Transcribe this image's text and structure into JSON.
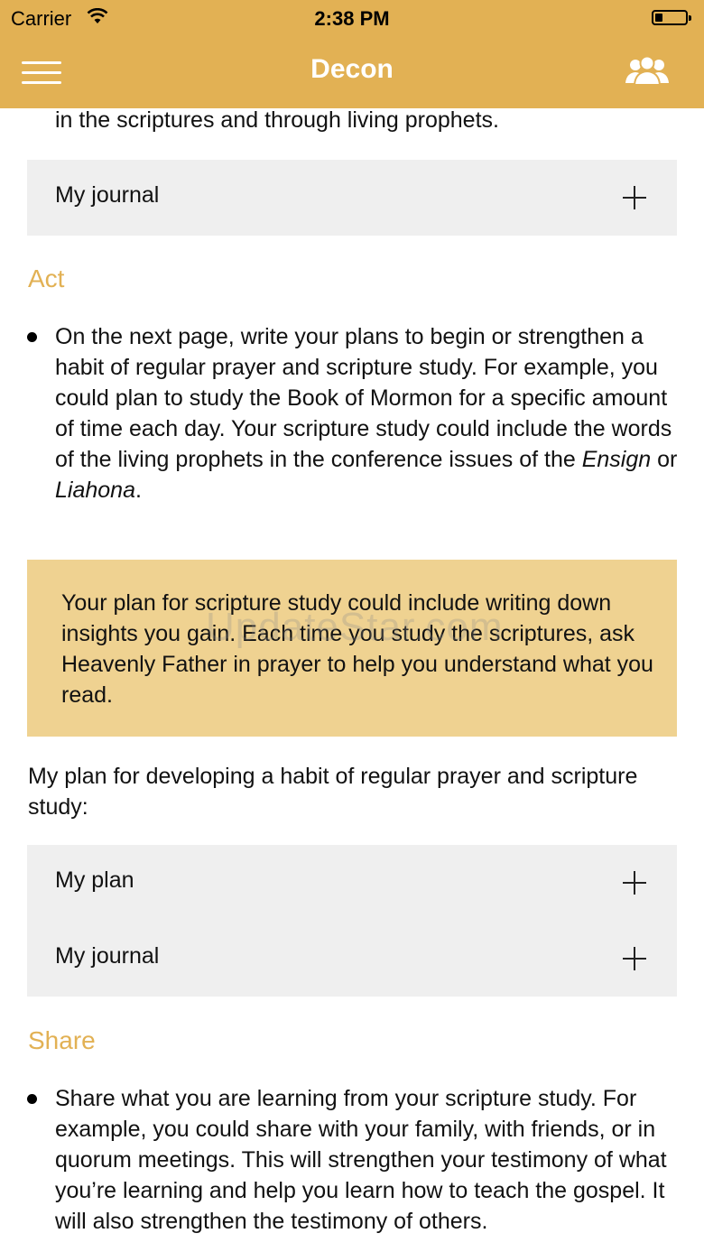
{
  "status_bar": {
    "carrier": "Carrier",
    "time": "2:38 PM"
  },
  "nav": {
    "title": "Decon",
    "menu_icon": "hamburger-menu-icon",
    "people_icon": "people-icon"
  },
  "intro_tail": "in the scriptures and through living prophets.",
  "journal_top": {
    "label": "My journal"
  },
  "act": {
    "heading": "Act",
    "bullet_pre": "On the next page, write your plans to begin or strengthen a habit of regular prayer and scripture study. For example, you could plan to study the Book of Mormon for a specific amount of time each day. Your scripture study could include the words of the living prophets in the conference issues of the ",
    "bullet_em1": "Ensign",
    "bullet_mid": " or ",
    "bullet_em2": "Liahona",
    "bullet_end": "."
  },
  "note": {
    "text": "Your plan for scripture study could include writing down insights you gain. Each time you study the scriptures, ask Heavenly Father in prayer to help you understand what you read."
  },
  "plan_prompt": "My plan for developing a habit of regular prayer and scripture study:",
  "plan_accordion": {
    "plan_label": "My plan",
    "journal_label": "My journal"
  },
  "share": {
    "heading": "Share",
    "bullet": "Share what you are learning from your scripture study. For example, you could share with your family, with friends, or in quorum meetings. This will strengthen your testimony of what you’re learning and help you learn how to teach the gospel. It will also strengthen the testimony of others."
  },
  "watermark": "UpdateStar.com",
  "colors": {
    "accent": "#e2b154",
    "note_bg": "#efd291",
    "panel_bg": "#efefef"
  }
}
